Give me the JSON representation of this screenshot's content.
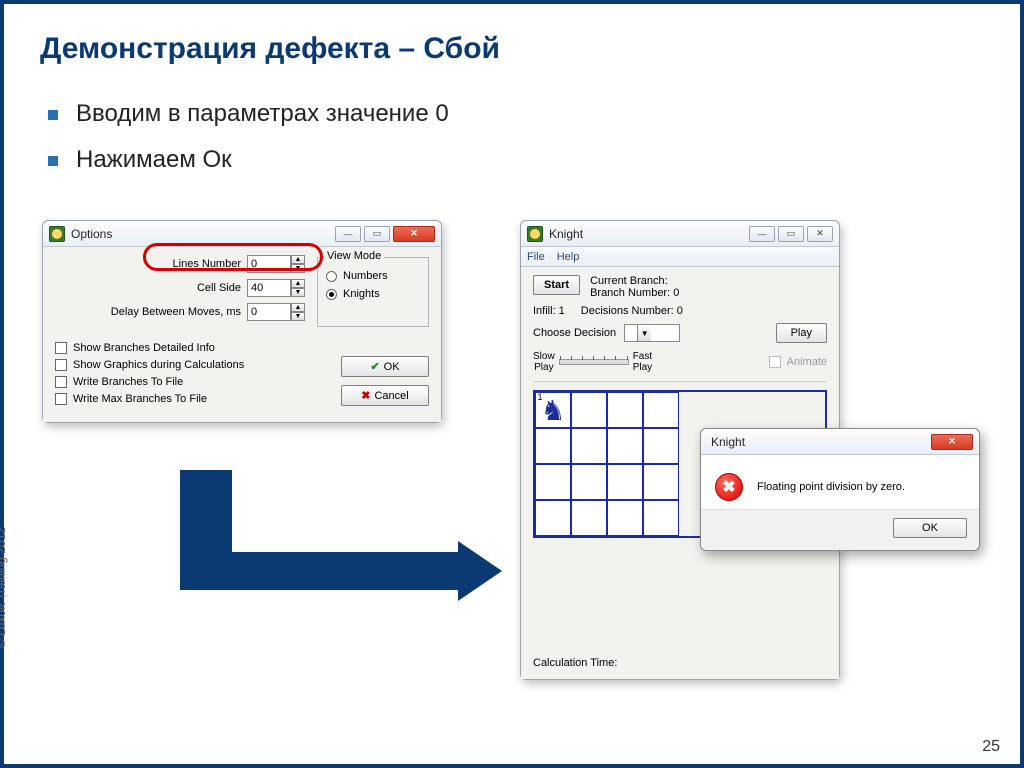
{
  "slide": {
    "title": "Демонстрация дефекта – Сбой",
    "bullets": [
      "Вводим в параметрах значение 0",
      "Нажимаем Ок"
    ],
    "page_number": "25",
    "copyright": "© Luxoft Training 2012"
  },
  "options_win": {
    "title": "Options",
    "lines_number_label": "Lines Number",
    "lines_number_value": "0",
    "cell_side_label": "Cell Side",
    "cell_side_value": "40",
    "delay_label": "Delay Between Moves, ms",
    "delay_value": "0",
    "view_mode_label": "View Mode",
    "radio_numbers": "Numbers",
    "radio_knights": "Knights",
    "chk1": "Show Branches Detailed Info",
    "chk2": "Show Graphics during Calculations",
    "chk3": "Write Branches To File",
    "chk4": "Write Max Branches To File",
    "ok": "OK",
    "cancel": "Cancel"
  },
  "knight_win": {
    "title": "Knight",
    "menu_file": "File",
    "menu_help": "Help",
    "start": "Start",
    "current_branch": "Current Branch:",
    "branch_number": "Branch Number: 0",
    "infill": "Infill: 1",
    "decisions_number": "Decisions Number: 0",
    "choose_decision": "Choose Decision",
    "play": "Play",
    "slow_play": "Slow\nPlay",
    "fast_play": "Fast\nPlay",
    "animate": "Animate",
    "cell1": "1",
    "calc_time": "Calculation Time:"
  },
  "error_dlg": {
    "title": "Knight",
    "message": "Floating point division by zero.",
    "ok": "OK"
  }
}
